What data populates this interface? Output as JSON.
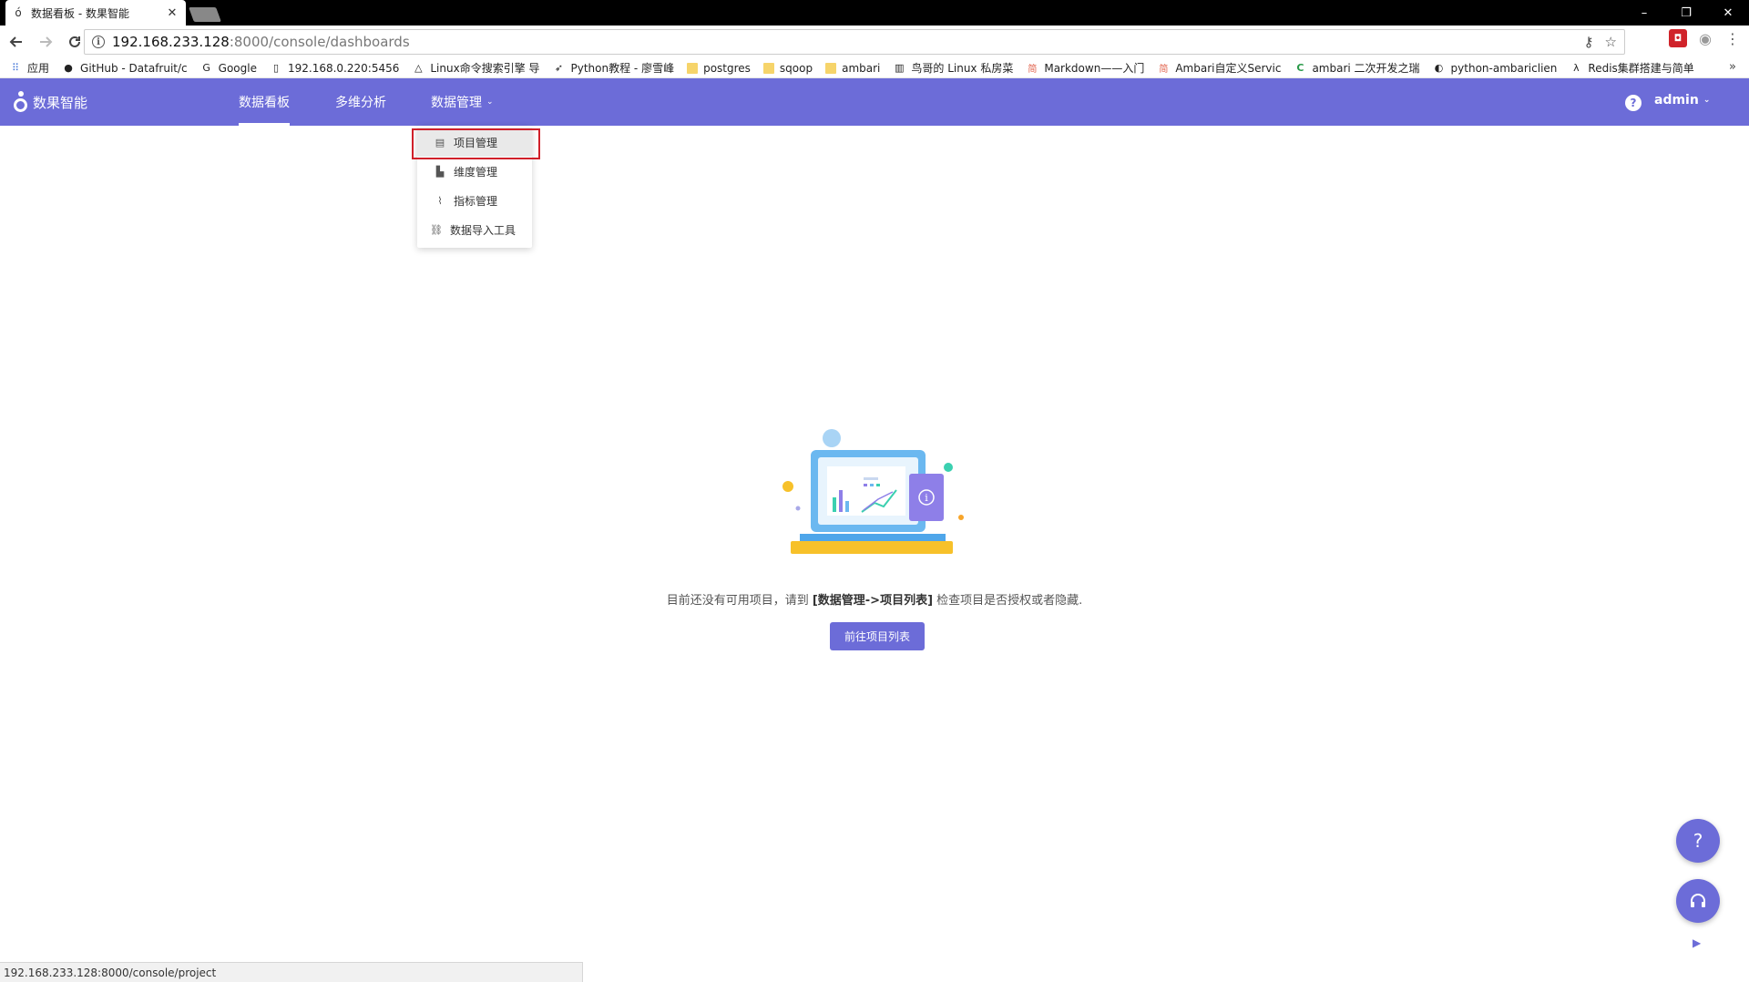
{
  "browser": {
    "tab_title": "数据看板 - 数果智能",
    "tab_close": "✕",
    "window_controls": {
      "minimize": "–",
      "restore": "❐",
      "close": "✕"
    },
    "url_host": "192.168.233.128",
    "url_path": ":8000/console/dashboards",
    "bookmarks": [
      {
        "label": "应用",
        "icon": "apps-grid-icon"
      },
      {
        "label": "GitHub - Datafruit/c",
        "icon": "github-icon"
      },
      {
        "label": "Google",
        "icon": "google-icon"
      },
      {
        "label": "192.168.0.220:5456",
        "icon": "page-icon"
      },
      {
        "label": "Linux命令搜索引擎 导",
        "icon": "linux-icon"
      },
      {
        "label": "Python教程 - 廖雪峰",
        "icon": "rocket-icon"
      },
      {
        "label": "postgres",
        "icon": "folder-icon"
      },
      {
        "label": "sqoop",
        "icon": "folder-icon"
      },
      {
        "label": "ambari",
        "icon": "folder-icon"
      },
      {
        "label": "鸟哥的 Linux 私房菜",
        "icon": "bird-icon"
      },
      {
        "label": "Markdown——入门",
        "icon": "jianshu-icon"
      },
      {
        "label": "Ambari自定义Servic",
        "icon": "jianshu-icon"
      },
      {
        "label": "ambari 二次开发之瑞",
        "icon": "c-icon"
      },
      {
        "label": "python-ambariclien",
        "icon": "python-icon"
      },
      {
        "label": "Redis集群搭建与简单",
        "icon": "lambda-icon"
      }
    ],
    "bookmarks_more": "»",
    "status_url": "192.168.233.128:8000/console/project"
  },
  "app": {
    "logo_text": "数果智能",
    "nav": [
      {
        "label": "数据看板",
        "active": true
      },
      {
        "label": "多维分析",
        "active": false
      },
      {
        "label": "数据管理",
        "active": false,
        "caret": "⌄"
      }
    ],
    "help": "?",
    "user": "admin",
    "user_caret": "⌄",
    "dropdown": [
      {
        "label": "项目管理",
        "icon": "list-icon",
        "glyph": "▤"
      },
      {
        "label": "维度管理",
        "icon": "bar-chart-icon",
        "glyph": "▙"
      },
      {
        "label": "指标管理",
        "icon": "line-chart-icon",
        "glyph": "⌇"
      },
      {
        "label": "数据导入工具",
        "icon": "link-icon",
        "glyph": "⛓"
      }
    ],
    "empty_state": {
      "prefix": "目前还没有可用项目，请到 ",
      "emphasis": "[数据管理->项目列表]",
      "suffix": " 检查项目是否授权或者隐藏.",
      "button": "前往项目列表"
    },
    "fab_help": "?",
    "fab_support": "☊",
    "fab_arrow": "▶"
  },
  "colors": {
    "brand": "#6c6cd8",
    "highlight_border": "#d0202a"
  }
}
